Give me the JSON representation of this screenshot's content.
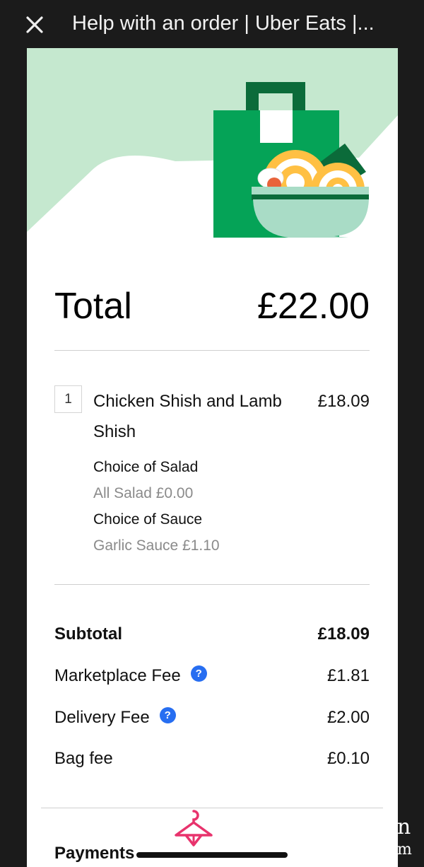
{
  "window": {
    "title": "Help with an order | Uber Eats |..."
  },
  "receipt": {
    "total_label": "Total",
    "total_amount": "£22.00",
    "item": {
      "quantity": "1",
      "name": "Chicken Shish and Lamb Shish",
      "price": "£18.09",
      "options": [
        {
          "heading": "Choice of Salad",
          "value": "All Salad £0.00"
        },
        {
          "heading": "Choice of Sauce",
          "value": "Garlic Sauce £1.10"
        }
      ]
    },
    "fees": [
      {
        "label": "Subtotal",
        "amount": "£18.09",
        "bold": true,
        "help": false
      },
      {
        "label": "Marketplace Fee",
        "amount": "£1.81",
        "bold": false,
        "help": true
      },
      {
        "label": "Delivery Fee",
        "amount": "£2.00",
        "bold": false,
        "help": true
      },
      {
        "label": "Bag fee",
        "amount": "£0.10",
        "bold": false,
        "help": false
      }
    ],
    "help_icon_glyph": "?",
    "payments_label": "Payments"
  },
  "overlay": {
    "corner_letters": [
      "n",
      "m"
    ]
  },
  "colors": {
    "hero_bg": "#c5e8cf",
    "bag_green": "#05a357",
    "bag_dark": "#0b6b3a",
    "bowl": "#a9dcc6",
    "noodle": "#ffc043",
    "help_blue": "#276ef1",
    "hanger_pink": "#e8336d"
  },
  "icons": [
    "close-icon",
    "help-circle-icon",
    "hanger-icon",
    "food-bag-illustration"
  ]
}
